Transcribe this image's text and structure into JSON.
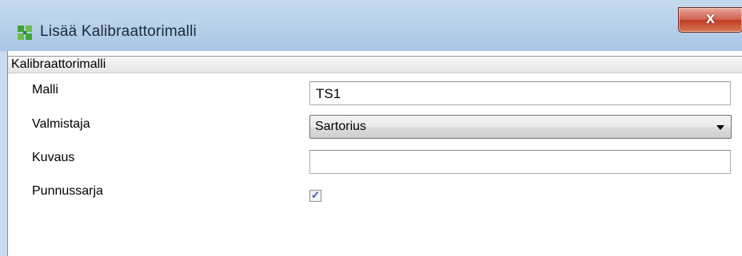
{
  "window": {
    "title": "Lisää Kalibraattorimalli",
    "close_glyph": "x",
    "icon": "app-icon"
  },
  "group": {
    "header": "Kalibraattorimalli"
  },
  "form": {
    "malli": {
      "label": "Malli",
      "value": "TS1"
    },
    "valmistaja": {
      "label": "Valmistaja",
      "value": "Sartorius"
    },
    "kuvaus": {
      "label": "Kuvaus",
      "value": ""
    },
    "punnussarja": {
      "label": "Punnussarja",
      "checked": true,
      "check_glyph": "✓"
    }
  },
  "colors": {
    "titlebar": "#b9d1ea",
    "close_button": "#c13b24",
    "checkmark": "#3b57a1"
  }
}
